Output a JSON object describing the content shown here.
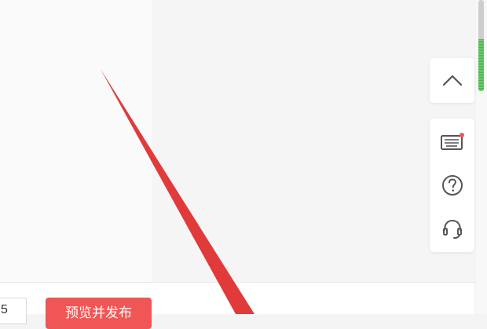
{
  "bottom_bar": {
    "page_input_value": "5",
    "preview_publish_label": "预览并发布"
  },
  "side_toolbar": {
    "back_to_top_icon": "chevron-up-icon",
    "keyboard_icon": "keyboard-icon",
    "help_icon": "question-icon",
    "support_icon": "headset-icon",
    "notification_color": "#f35656"
  },
  "scrollbar": {
    "progress_fraction": 0.57,
    "progress_color": "#49b449"
  },
  "colors": {
    "primary_button": "#f05656",
    "annotation_arrow": "#e13a3a"
  }
}
